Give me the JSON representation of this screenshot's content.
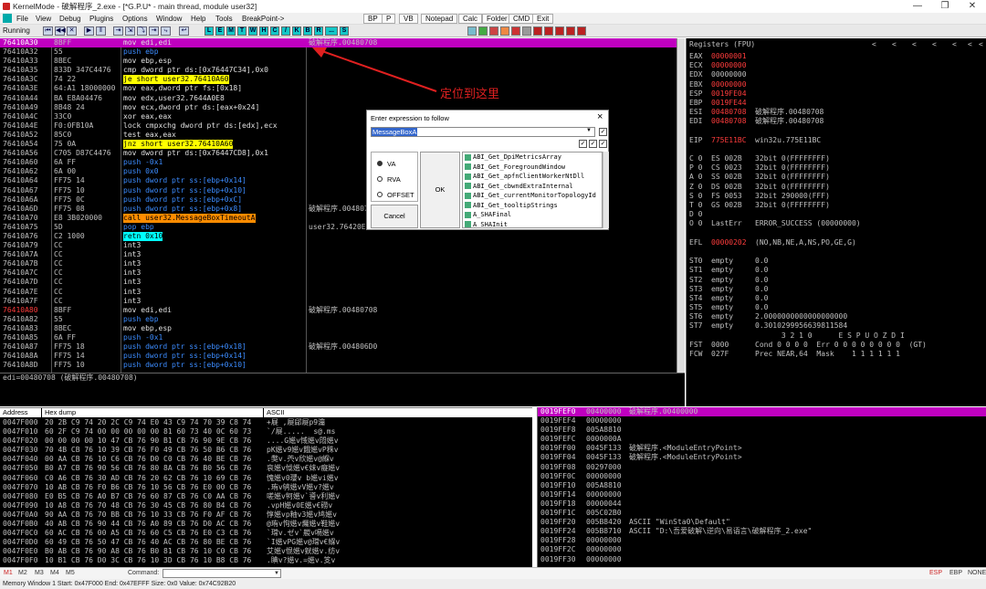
{
  "window": {
    "title": "KernelMode - 破解程序_2.exe - [*G.P.U* - main thread, module user32]",
    "controls": [
      "—",
      "❐",
      "✕"
    ]
  },
  "menu": {
    "items": [
      "File",
      "View",
      "Debug",
      "Plugins",
      "Options",
      "Window",
      "Help",
      "Tools",
      "BreakPoint->"
    ],
    "buttons": [
      "BP",
      "P",
      "VB",
      "Notepad",
      "Calc",
      "Folder",
      "CMD",
      "Exit"
    ]
  },
  "toolbar": {
    "state": "Running",
    "nav_buttons": [
      "⏮",
      "◀◀",
      "✕",
      "▶",
      "‖",
      "⇥",
      "⇲",
      "⤵",
      "⇥",
      "⤷",
      "↩"
    ],
    "letters": [
      "L",
      "E",
      "M",
      "T",
      "W",
      "H",
      "C",
      "/",
      "K",
      "B",
      "R",
      "...",
      "S"
    ]
  },
  "disasm": {
    "rows": [
      {
        "addr": "76410A30",
        "hex": "8BFF",
        "instr": "mov edi,edi",
        "comment": "破解程序.00480708",
        "addr_red": true,
        "sel": true
      },
      {
        "addr": "76410A32",
        "hex": "55",
        "instr": "push ebp",
        "comment": ""
      },
      {
        "addr": "76410A33",
        "hex": "8BEC",
        "instr": "mov ebp,esp",
        "comment": ""
      },
      {
        "addr": "76410A35",
        "hex": "833D 347C4476",
        "instr": "cmp dword ptr ds:[0x76447C34],0x0",
        "comment": ""
      },
      {
        "addr": "76410A3C",
        "hex": "74 22",
        "instr": "je short user32.76410A60",
        "comment": ""
      },
      {
        "addr": "76410A3E",
        "hex": "64:A1 18000000",
        "instr": "mov eax,dword ptr fs:[0x18]",
        "comment": ""
      },
      {
        "addr": "76410A44",
        "hex": "BA E8A04476",
        "instr": "mov edx,user32.7644A0E8",
        "comment": ""
      },
      {
        "addr": "76410A49",
        "hex": "8B48 24",
        "instr": "mov ecx,dword ptr ds:[eax+0x24]",
        "comment": ""
      },
      {
        "addr": "76410A4C",
        "hex": "33C0",
        "instr": "xor eax,eax",
        "comment": ""
      },
      {
        "addr": "76410A4E",
        "hex": "F0:0FB10A",
        "instr": "lock cmpxchg dword ptr ds:[edx],ecx",
        "comment": ""
      },
      {
        "addr": "76410A52",
        "hex": "85C0",
        "instr": "test eax,eax",
        "comment": ""
      },
      {
        "addr": "76410A54",
        "hex": "75 0A",
        "instr": "jnz short user32.76410A60",
        "comment": ""
      },
      {
        "addr": "76410A56",
        "hex": "C705 D87C4476",
        "instr": "mov dword ptr ds:[0x76447CD8],0x1",
        "comment": ""
      },
      {
        "addr": "76410A60",
        "hex": "6A FF",
        "instr": "push -0x1",
        "comment": ""
      },
      {
        "addr": "76410A62",
        "hex": "6A 00",
        "instr": "push 0x0",
        "comment": ""
      },
      {
        "addr": "76410A64",
        "hex": "FF75 14",
        "instr": "push dword ptr ss:[ebp+0x14]",
        "comment": ""
      },
      {
        "addr": "76410A67",
        "hex": "FF75 10",
        "instr": "push dword ptr ss:[ebp+0x10]",
        "comment": ""
      },
      {
        "addr": "76410A6A",
        "hex": "FF75 0C",
        "instr": "push dword ptr ss:[ebp+0xC]",
        "comment": ""
      },
      {
        "addr": "76410A6D",
        "hex": "FF75 08",
        "instr": "push dword ptr ss:[ebp+0x8]",
        "comment": "破解程序.00480708"
      },
      {
        "addr": "76410A70",
        "hex": "E8 3B020000",
        "instr": "call user32.MessageBoxTimeoutA",
        "comment": ""
      },
      {
        "addr": "76410A75",
        "hex": "5D",
        "instr": "pop ebp",
        "comment": "user32.76420E2"
      },
      {
        "addr": "76410A76",
        "hex": "C2 1000",
        "instr": "retn 0x10",
        "comment": ""
      },
      {
        "addr": "76410A79",
        "hex": "CC",
        "instr": "int3",
        "comment": ""
      },
      {
        "addr": "76410A7A",
        "hex": "CC",
        "instr": "int3",
        "comment": ""
      },
      {
        "addr": "76410A7B",
        "hex": "CC",
        "instr": "int3",
        "comment": ""
      },
      {
        "addr": "76410A7C",
        "hex": "CC",
        "instr": "int3",
        "comment": ""
      },
      {
        "addr": "76410A7D",
        "hex": "CC",
        "instr": "int3",
        "comment": ""
      },
      {
        "addr": "76410A7E",
        "hex": "CC",
        "instr": "int3",
        "comment": ""
      },
      {
        "addr": "76410A7F",
        "hex": "CC",
        "instr": "int3",
        "comment": ""
      },
      {
        "addr": "76410A80",
        "hex": "8BFF",
        "instr": "mov edi,edi",
        "comment": "破解程序.00480708",
        "addr_red": true
      },
      {
        "addr": "76410A82",
        "hex": "55",
        "instr": "push ebp",
        "comment": ""
      },
      {
        "addr": "76410A83",
        "hex": "8BEC",
        "instr": "mov ebp,esp",
        "comment": ""
      },
      {
        "addr": "76410A85",
        "hex": "6A FF",
        "instr": "push -0x1",
        "comment": ""
      },
      {
        "addr": "76410A87",
        "hex": "FF75 18",
        "instr": "push dword ptr ss:[ebp+0x18]",
        "comment": "破解程序.004806D0"
      },
      {
        "addr": "76410A8A",
        "hex": "FF75 14",
        "instr": "push dword ptr ss:[ebp+0x14]",
        "comment": ""
      },
      {
        "addr": "76410A8D",
        "hex": "FF75 10",
        "instr": "push dword ptr ss:[ebp+0x10]",
        "comment": ""
      }
    ],
    "info": "edi=00480708 (破解程序.00480708)"
  },
  "annotation": "定位到这里",
  "dialog": {
    "title": "Enter expression to follow",
    "close": "×",
    "expression_value": "MessageBoxA",
    "radios": [
      "VA",
      "RVA",
      "OFFSET"
    ],
    "selected_radio": "VA",
    "ok": "OK",
    "cancel": "Cancel",
    "suggestions": [
      "ABI_Get_DpiMetricsArray",
      "ABI_Get_ForegroundWindow",
      "ABI_Get_apfnClientWorkerNtDll",
      "ABI_Get_cbwndExtraInternal",
      "ABI_Get_currentMonitorTopologyId",
      "ABI_Get_tooltipStrings",
      "A_SHAFinal",
      "A_SHAInit"
    ]
  },
  "registers": {
    "title": "Registers (FPU)",
    "nav": [
      "<",
      "<",
      "<",
      "<",
      "<",
      "<",
      "<"
    ],
    "rows": [
      {
        "name": "EAX",
        "value": "00000001",
        "note": "",
        "red": true
      },
      {
        "name": "ECX",
        "value": "00000000",
        "note": "",
        "red": true
      },
      {
        "name": "EDX",
        "value": "00000000",
        "note": ""
      },
      {
        "name": "EBX",
        "value": "00000000",
        "note": "",
        "red": true
      },
      {
        "name": "ESP",
        "value": "0019FE04",
        "note": "",
        "red": true
      },
      {
        "name": "EBP",
        "value": "0019FE44",
        "note": "",
        "red": true
      },
      {
        "name": "ESI",
        "value": "00480708",
        "note": "破解程序.00480708",
        "red": true
      },
      {
        "name": "EDI",
        "value": "00480708",
        "note": "破解程序.00480708",
        "red": true
      },
      {
        "name": "",
        "value": "",
        "note": ""
      },
      {
        "name": "EIP",
        "value": "775E11BC",
        "note": "win32u.775E11BC",
        "red": true
      },
      {
        "name": "",
        "value": "",
        "note": ""
      },
      {
        "name": "C 0",
        "value": "ES 002B",
        "note": "32bit 0(FFFFFFFF)"
      },
      {
        "name": "P 0",
        "value": "CS 0023",
        "note": "32bit 0(FFFFFFFF)"
      },
      {
        "name": "A 0",
        "value": "SS 002B",
        "note": "32bit 0(FFFFFFFF)"
      },
      {
        "name": "Z 0",
        "value": "DS 002B",
        "note": "32bit 0(FFFFFFFF)"
      },
      {
        "name": "S 0",
        "value": "FS 0053",
        "note": "32bit 290000(FFF)"
      },
      {
        "name": "T 0",
        "value": "GS 002B",
        "note": "32bit 0(FFFFFFFF)"
      },
      {
        "name": "D 0",
        "value": "",
        "note": ""
      },
      {
        "name": "O 0",
        "value": "LastErr",
        "note": "ERROR_SUCCESS (00000000)"
      },
      {
        "name": "",
        "value": "",
        "note": ""
      },
      {
        "name": "EFL",
        "value": "00000202",
        "note": "(NO,NB,NE,A,NS,PO,GE,G)",
        "red": true
      },
      {
        "name": "",
        "value": "",
        "note": ""
      },
      {
        "name": "ST0",
        "value": "empty",
        "note": "0.0"
      },
      {
        "name": "ST1",
        "value": "empty",
        "note": "0.0"
      },
      {
        "name": "ST2",
        "value": "empty",
        "note": "0.0"
      },
      {
        "name": "ST3",
        "value": "empty",
        "note": "0.0"
      },
      {
        "name": "ST4",
        "value": "empty",
        "note": "0.0"
      },
      {
        "name": "ST5",
        "value": "empty",
        "note": "0.0"
      },
      {
        "name": "ST6",
        "value": "empty",
        "note": "2.0000000000000000000"
      },
      {
        "name": "ST7",
        "value": "empty",
        "note": "0.3010299956639811584"
      },
      {
        "name": "",
        "value": "",
        "note": "      3 2 1 0      E S P U O Z D I"
      },
      {
        "name": "FST",
        "value": "0000",
        "note": "Cond 0 0 0 0  Err 0 0 0 0 0 0 0 0  (GT)"
      },
      {
        "name": "FCW",
        "value": "027F",
        "note": "Prec NEAR,64  Mask    1 1 1 1 1 1"
      }
    ]
  },
  "dump": {
    "headers": {
      "address": "Address",
      "hex": "Hex dump",
      "ascii": "ASCII"
    },
    "rows": [
      {
        "addr": "0047F000",
        "hex": "20 2B C9 74 20 2C C9 74 E0 43 C9 74 70 39 C8 74",
        "ascii": "+屣 ,屣郈屣p9瀹"
      },
      {
        "addr": "0047F010",
        "hex": "60 2F C9 74 00 00 00 00 00 81 60 73 40 0C 60 73",
        "ascii": "`/屣.....  s@.ms"
      },
      {
        "addr": "0047F020",
        "hex": "00 00 00 00 10 47 CB 76 90 B1 CB 76 90 9E CB 76",
        "ascii": "....G嬨v惐嬨v悶嬨v"
      },
      {
        "addr": "0047F030",
        "hex": "70 4B CB 76 10 39 CB 76 F0 49 CB 76 50 B6 CB 76",
        "ascii": "pK嬨v9嬨v餓嬨vP秼v"
      },
      {
        "addr": "0047F040",
        "hex": "00 AA CB 76 10 C6 CB 76 D0 C0 CB 76 40 BE CB 76",
        "ascii": ".獘v.茓v欣嬨v@緥v"
      },
      {
        "addr": "0047F050",
        "hex": "B0 A7 CB 76 90 56 CB 76 80 8A CB 76 B0 56 CB 76",
        "ascii": "哀嬨v怴嬨v€妺v癡嬨v"
      },
      {
        "addr": "0047F060",
        "hex": "C0 A6 CB 76 30 AD CB 76 20 62 CB 76 10 69 CB 76",
        "ascii": "愧嬨v0瓔v b嬨vi嬨v"
      },
      {
        "addr": "0047F070",
        "hex": "10 AB CB 76 F0 B6 CB 76 10 56 CB 76 E0 00 CB 76",
        "ascii": ".珛v鸲嬨vV嬨v?嬨v"
      },
      {
        "addr": "0047F080",
        "hex": "E0 B5 CB 76 A0 B7 CB 76 60 87 CB 76 C0 AA CB 76",
        "ascii": "嗟嬨v牱嬨v`噵v利嬨v"
      },
      {
        "addr": "0047F090",
        "hex": "10 A8 CB 76 70 48 CB 76 30 45 CB 76 80 B4 CB 76",
        "ascii": ".vpH嬨v0E嬨v€磱v"
      },
      {
        "addr": "0047F0A0",
        "hex": "90 AA CB 76 70 BB CB 76 10 33 CB 76 F0 AF CB 76",
        "ascii": "惇嬨vp粙v3嬨v鸠嬨v"
      },
      {
        "addr": "0047F0B0",
        "hex": "40 AB CB 76 90 44 CB 76 A0 89 CB 76 D0 AC CB 76",
        "ascii": "@珛v怐嬨v爥嬨v鞋嬨v"
      },
      {
        "addr": "0047F0C0",
        "hex": "60 AC CB 76 00 A5 CB 76 60 C5 CB 76 E0 C3 CB 76",
        "ascii": "`瑺v.ゼv`艐v嗝嬨v"
      },
      {
        "addr": "0047F0D0",
        "hex": "60 49 CB 76 50 47 CB 76 40 AC CB 76 80 BE CB 76",
        "ascii": "`I嬨vPG嬨v@瑺v€緥v"
      },
      {
        "addr": "0047F0E0",
        "hex": "B0 AB CB 76 90 A8 CB 76 B0 81 CB 76 10 C0 CB 76",
        "ascii": "艾嬨v惃嬨v皝嬨v.纺v"
      },
      {
        "addr": "0047F0F0",
        "hex": "10 B1 CB 76 D0 3C CB 76 10 3D CB 76 10 B8 CB 76",
        "ascii": ".睓v?嬨v.=嬨v.笅v"
      }
    ]
  },
  "stack": {
    "rows": [
      {
        "addr": "0019FEF0",
        "value": "00400000",
        "note": "破解程序.00400000",
        "sel": true
      },
      {
        "addr": "0019FEF4",
        "value": "00000000",
        "note": ""
      },
      {
        "addr": "0019FEF8",
        "value": "005A8810",
        "note": ""
      },
      {
        "addr": "0019FEFC",
        "value": "0000000A",
        "note": ""
      },
      {
        "addr": "0019FF00",
        "value": "0045F133",
        "note": "破解程序.<ModuleEntryPoint>"
      },
      {
        "addr": "0019FF04",
        "value": "0045F133",
        "note": "破解程序.<ModuleEntryPoint>"
      },
      {
        "addr": "0019FF08",
        "value": "00297000",
        "note": ""
      },
      {
        "addr": "0019FF0C",
        "value": "00000000",
        "note": ""
      },
      {
        "addr": "0019FF10",
        "value": "005A8810",
        "note": ""
      },
      {
        "addr": "0019FF14",
        "value": "00000000",
        "note": ""
      },
      {
        "addr": "0019FF18",
        "value": "00000044",
        "note": ""
      },
      {
        "addr": "0019FF1C",
        "value": "005C02B0",
        "note": ""
      },
      {
        "addr": "0019FF20",
        "value": "005B8420",
        "note": "ASCII \"WinSta0\\Default\""
      },
      {
        "addr": "0019FF24",
        "value": "005B8710",
        "note": "ASCII \"D:\\吾爱破解\\逆向\\易语言\\破解程序_2.exe\""
      },
      {
        "addr": "0019FF28",
        "value": "00000000",
        "note": ""
      },
      {
        "addr": "0019FF2C",
        "value": "00000000",
        "note": ""
      },
      {
        "addr": "0019FF30",
        "value": "00000000",
        "note": ""
      }
    ]
  },
  "tabs": {
    "memory": [
      "M1",
      "M2",
      "M3",
      "M4",
      "M5"
    ],
    "command_label": "Command:",
    "right": [
      "ESP",
      "EBP",
      "NONE"
    ]
  },
  "status": {
    "text": "Memory Window 1  Start: 0x47F000  End: 0x47EFFF  Size: 0x0 Value: 0x74C92B20"
  },
  "colors": {
    "background": "#000000",
    "address": "#c0c0c0",
    "address_red": "#ff3c3c",
    "selection": "#c000c0",
    "call_bg": "#ff8c00",
    "jump_bg": "#ffff00",
    "push_fg": "#3c8cff",
    "annotation": "#e02020"
  }
}
